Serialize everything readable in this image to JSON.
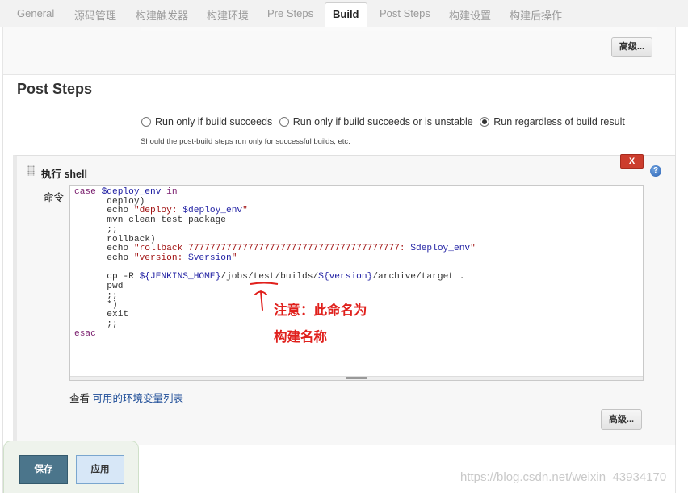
{
  "tabs": [
    {
      "label": "General",
      "active": false
    },
    {
      "label": "源码管理",
      "active": false
    },
    {
      "label": "构建触发器",
      "active": false
    },
    {
      "label": "构建环境",
      "active": false
    },
    {
      "label": "Pre Steps",
      "active": false
    },
    {
      "label": "Build",
      "active": true
    },
    {
      "label": "Post Steps",
      "active": false
    },
    {
      "label": "构建设置",
      "active": false
    },
    {
      "label": "构建后操作",
      "active": false
    }
  ],
  "build_section": {
    "advanced_label": "高级..."
  },
  "post_steps": {
    "title": "Post Steps",
    "options": [
      {
        "label": "Run only if build succeeds",
        "checked": false
      },
      {
        "label": "Run only if build succeeds or is unstable",
        "checked": false
      },
      {
        "label": "Run regardless of build result",
        "checked": true
      }
    ],
    "hint": "Should the post-build steps run only for successful builds, etc."
  },
  "shell_step": {
    "title": "执行 shell",
    "delete_label": "X",
    "help_label": "?",
    "command_label": "命令",
    "command_lines": [
      "case $deploy_env in",
      "      deploy)",
      "      echo \"deploy: $deploy_env\"",
      "      mvn clean test package",
      "      ;;",
      "      rollback)",
      "      echo \"rollback 777777777777777777777777777777777777777: $deploy_env\"",
      "      echo \"version: $version\"",
      "",
      "      cp -R ${JENKINS_HOME}/jobs/test/builds/${version}/archive/target .",
      "      pwd",
      "      ;;",
      "      *)",
      "      exit",
      "      ;;",
      "esac"
    ],
    "env_prefix": "查看 ",
    "env_link": "可用的环境变量列表",
    "advanced_label": "高级..."
  },
  "annotation": {
    "line1": "注意：此命名为",
    "line2": "构建名称",
    "color": "#e0201c"
  },
  "footer": {
    "save_label": "保存",
    "apply_label": "应用"
  },
  "watermark": "https://blog.csdn.net/weixin_43934170"
}
